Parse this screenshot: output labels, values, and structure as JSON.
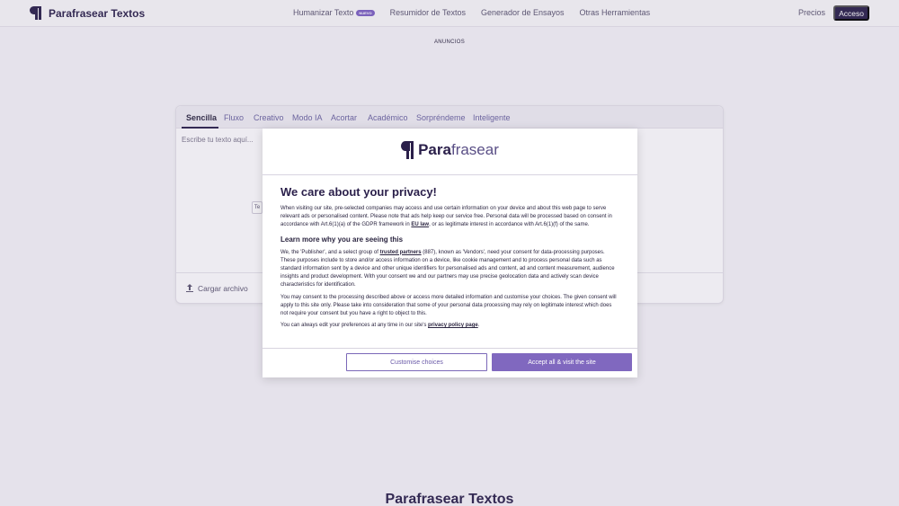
{
  "header": {
    "brand": "Parafrasear Textos",
    "nav": [
      {
        "label": "Humanizar Texto",
        "badge": "NUEVO"
      },
      {
        "label": "Resumidor de Textos"
      },
      {
        "label": "Generador de Ensayos"
      },
      {
        "label": "Otras Herramientas"
      }
    ],
    "precios": "Precios",
    "acceso": "Acceso"
  },
  "ads_label": "ANUNCIOS",
  "editor": {
    "tabs": [
      "Sencilla",
      "Fluxo",
      "Creativo",
      "Modo IA",
      "Acortar",
      "Académico",
      "Sorpréndeme",
      "Inteligente"
    ],
    "active_tab": "Sencilla",
    "placeholder": "Escribe tu texto aquí...",
    "stub": "Te",
    "upload_label": "Cargar archivo"
  },
  "bottom_title": "Parafrasear Textos",
  "consent": {
    "logo_bold": "Para",
    "logo_rest": "frasear",
    "title": "We care about your privacy!",
    "p1_a": "When visiting our site, pre-selected companies may access and use certain information on your device and about this web page to serve relevant ads or personalised content. Please note that ads help keep our service free. Personal data will be processed based on consent in accordance with Art.6(1)(a) of the GDPR framework in ",
    "p1_link": "EU law",
    "p1_b": ", or as legitimate interest in accordance with Art.6(1)(f) of the same.",
    "subtitle": "Learn more why you are seeing this",
    "p2_a": "We, the 'Publisher', and a select group of ",
    "p2_link": "trusted partners",
    "p2_b": " (887), known as 'Vendors', need your consent for data-processing purposes. These purposes include to store and/or access information on a device, like cookie management and to process personal data such as standard information sent by a device and other unique identifiers for personalised ads and content, ad and content measurement, audience insights and product development. With your consent we and our partners may use precise geolocation data and actively scan device characteristics for identification.",
    "p3": "You may consent to the processing described above or access more detailed information and customise your choices. The given consent will apply to this site only. Please take into consideration that some of your personal data processing may rely on legitimate interest which does not require your consent but you have a right to object to this.",
    "p4_a": "You can always edit your preferences at any time in our site's ",
    "p4_link": "privacy policy page",
    "p4_b": ".",
    "customise_label": "Customise choices",
    "accept_label": "Accept all & visit the site",
    "colors": {
      "accent": "#8068bf",
      "brand": "#2a1f4a"
    }
  }
}
